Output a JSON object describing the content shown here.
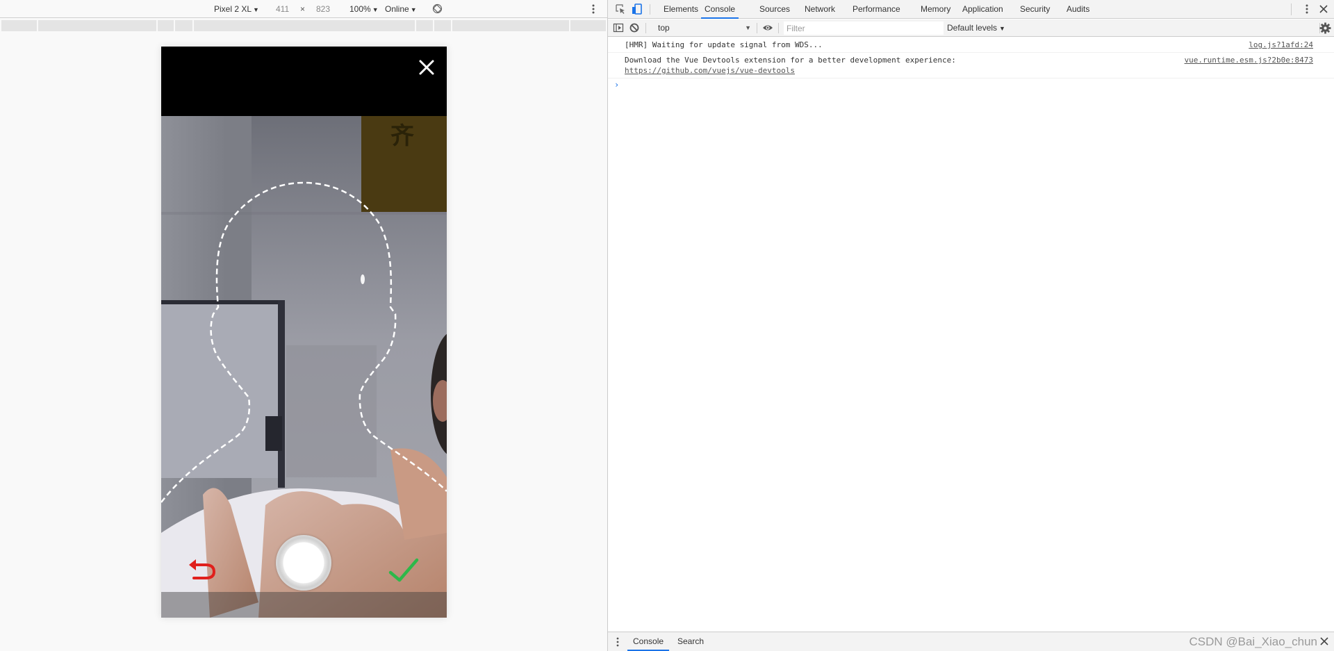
{
  "emulator": {
    "device": "Pixel 2 XL",
    "width": "411",
    "times": "×",
    "height": "823",
    "zoom": "100%",
    "network": "Online",
    "caret": "▼"
  },
  "phone": {
    "close_label": "Close",
    "undo_label": "Retake",
    "shutter_label": "Capture",
    "confirm_label": "Confirm",
    "colors": {
      "undo": "#e0201c",
      "confirm": "#2db84a",
      "outline": "#ffffff"
    }
  },
  "devtools": {
    "tabs": [
      {
        "label": "Elements",
        "active": false
      },
      {
        "label": "Console",
        "active": true
      },
      {
        "label": "Sources",
        "active": false
      },
      {
        "label": "Network",
        "active": false
      },
      {
        "label": "Performance",
        "active": false
      },
      {
        "label": "Memory",
        "active": false
      },
      {
        "label": "Application",
        "active": false
      },
      {
        "label": "Security",
        "active": false
      },
      {
        "label": "Audits",
        "active": false
      }
    ],
    "console_bar": {
      "context": "top",
      "filter_placeholder": "Filter",
      "levels": "Default levels",
      "caret": "▼"
    },
    "messages": [
      {
        "text": "[HMR] Waiting for update signal from WDS...",
        "source": "log.js?1afd:24"
      },
      {
        "text": "Download the Vue Devtools extension for a better development experience:",
        "link": "https://github.com/vuejs/vue-devtools",
        "source": "vue.runtime.esm.js?2b0e:8473"
      }
    ],
    "prompt": "›",
    "drawer": {
      "tabs": [
        {
          "label": "Console",
          "active": true
        },
        {
          "label": "Search",
          "active": false
        }
      ]
    },
    "accent": "#1a73e8"
  },
  "watermark": "CSDN @Bai_Xiao_chun"
}
